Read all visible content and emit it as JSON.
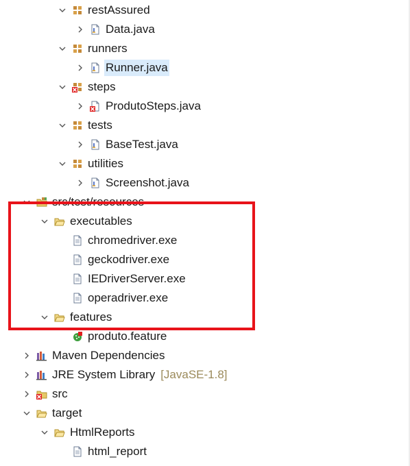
{
  "tree": [
    {
      "name": "tree-item-restassured",
      "label": "restAssured",
      "depth": 3,
      "chevron": "down",
      "icon": "package-icon"
    },
    {
      "name": "tree-item-data-java",
      "label": "Data.java",
      "depth": 4,
      "chevron": "right",
      "icon": "java-file-icon"
    },
    {
      "name": "tree-item-runners",
      "label": "runners",
      "depth": 3,
      "chevron": "down",
      "icon": "package-icon"
    },
    {
      "name": "tree-item-runner-java",
      "label": "Runner.java",
      "depth": 4,
      "chevron": "right",
      "icon": "java-file-icon",
      "selected": true
    },
    {
      "name": "tree-item-steps",
      "label": "steps",
      "depth": 3,
      "chevron": "down",
      "icon": "package-error-icon"
    },
    {
      "name": "tree-item-produtosteps-java",
      "label": "ProdutoSteps.java",
      "depth": 4,
      "chevron": "right",
      "icon": "java-file-error-icon"
    },
    {
      "name": "tree-item-tests",
      "label": "tests",
      "depth": 3,
      "chevron": "down",
      "icon": "package-icon"
    },
    {
      "name": "tree-item-basetest-java",
      "label": "BaseTest.java",
      "depth": 4,
      "chevron": "right",
      "icon": "java-file-icon"
    },
    {
      "name": "tree-item-utilities",
      "label": "utilities",
      "depth": 3,
      "chevron": "down",
      "icon": "package-icon"
    },
    {
      "name": "tree-item-screenshot-java",
      "label": "Screenshot.java",
      "depth": 4,
      "chevron": "right",
      "icon": "java-file-icon"
    },
    {
      "name": "tree-item-src-test-resources",
      "label": "src/test/resources",
      "depth": 1,
      "chevron": "down",
      "icon": "source-folder-icon"
    },
    {
      "name": "tree-item-executables",
      "label": "executables",
      "depth": 2,
      "chevron": "down",
      "icon": "open-folder-icon"
    },
    {
      "name": "tree-item-chromedriver",
      "label": "chromedriver.exe",
      "depth": 3,
      "chevron": "none",
      "icon": "file-icon"
    },
    {
      "name": "tree-item-geckodriver",
      "label": "geckodriver.exe",
      "depth": 3,
      "chevron": "none",
      "icon": "file-icon"
    },
    {
      "name": "tree-item-iedriverserver",
      "label": "IEDriverServer.exe",
      "depth": 3,
      "chevron": "none",
      "icon": "file-icon"
    },
    {
      "name": "tree-item-operadriver",
      "label": "operadriver.exe",
      "depth": 3,
      "chevron": "none",
      "icon": "file-icon"
    },
    {
      "name": "tree-item-features",
      "label": "features",
      "depth": 2,
      "chevron": "down",
      "icon": "open-folder-icon"
    },
    {
      "name": "tree-item-produto-feature",
      "label": "produto.feature",
      "depth": 3,
      "chevron": "none",
      "icon": "cucumber-feature-icon"
    },
    {
      "name": "tree-item-maven-dependencies",
      "label": "Maven Dependencies",
      "depth": 1,
      "chevron": "right",
      "icon": "library-icon"
    },
    {
      "name": "tree-item-jre-system-library",
      "label": "JRE System Library",
      "decor": "[JavaSE-1.8]",
      "depth": 1,
      "chevron": "right",
      "icon": "library-icon"
    },
    {
      "name": "tree-item-src",
      "label": "src",
      "depth": 1,
      "chevron": "right",
      "icon": "folder-error-icon"
    },
    {
      "name": "tree-item-target",
      "label": "target",
      "depth": 1,
      "chevron": "down",
      "icon": "open-folder-icon"
    },
    {
      "name": "tree-item-htmlreports",
      "label": "HtmlReports",
      "depth": 2,
      "chevron": "down",
      "icon": "open-folder-icon"
    },
    {
      "name": "tree-item-html-report",
      "label": "html_report",
      "depth": 3,
      "chevron": "none",
      "icon": "file-icon"
    }
  ],
  "colors": {
    "selection": "#d9ebfb",
    "highlight_border": "#e8131a",
    "decoration": "#9b8a5a"
  }
}
